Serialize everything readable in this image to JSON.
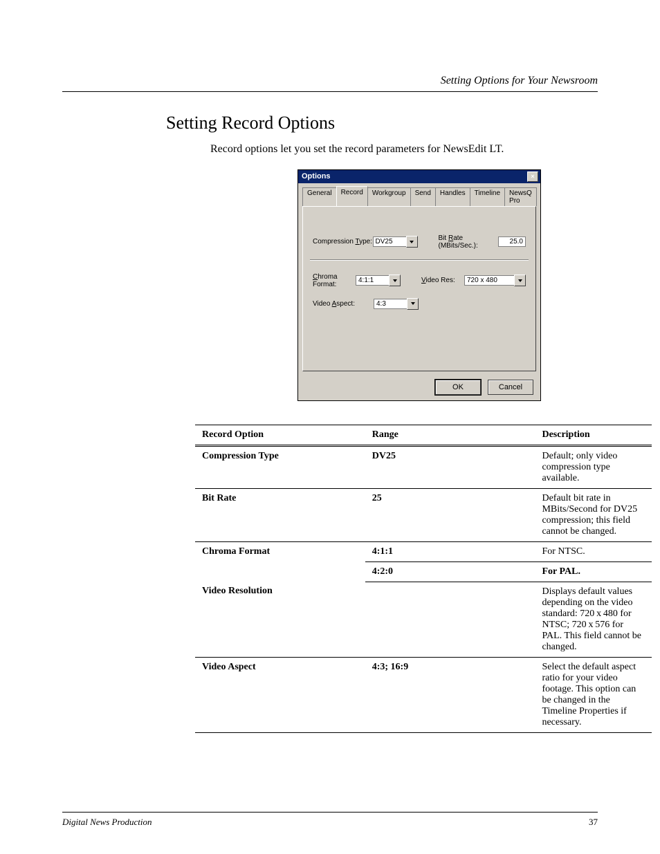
{
  "runningHead": "Setting Options for Your Newsroom",
  "section": {
    "title": "Setting Record Options",
    "para": "Record options let you set the record parameters for NewsEdit LT."
  },
  "dialog": {
    "title": "Options",
    "closeGlyph": "×",
    "tabs": [
      "General",
      "Record",
      "Workgroup",
      "Send",
      "Handles",
      "Timeline",
      "NewsQ Pro"
    ],
    "activeTabIndex": 1,
    "labels": {
      "compression": "Compression Type:",
      "bitrate": "Bit Rate (MBits/Sec.):",
      "chroma": "Chroma Format:",
      "videoRes": "Video Res:",
      "aspect": "Video Aspect:"
    },
    "values": {
      "compression": "DV25",
      "bitrate": "25.0",
      "chroma": "4:1:1",
      "videoRes": "720 x 480",
      "aspect": "4:3"
    },
    "buttons": {
      "ok": "OK",
      "cancel": "Cancel"
    }
  },
  "table": {
    "headers": [
      "Record Option",
      "Range",
      "Description"
    ],
    "rows": [
      {
        "opt": "Compression Type",
        "range": "DV25",
        "desc": "Default; only video compression type available."
      },
      {
        "opt": "Bit Rate",
        "range": "25",
        "desc": "Default bit rate in MBits/Second for DV25 compression; this field cannot be changed."
      },
      {
        "opt": "Chroma Format",
        "range": "4:1:1",
        "desc": "For NTSC.",
        "sub": true
      },
      {
        "opt": "",
        "range": "4:2:0",
        "desc": "For PAL."
      },
      {
        "opt": "Video Resolution",
        "range": "",
        "desc": "Displays default values depending on the video standard: 720 x 480 for NTSC; 720 x 576 for PAL. This field cannot be changed."
      },
      {
        "opt": "Video Aspect",
        "range": "4:3; 16:9",
        "desc": "Select the default aspect ratio for your video footage. This option can be changed in the Timeline Properties if necessary."
      }
    ]
  },
  "footer": {
    "manual": "Digital News Production",
    "page": "37"
  }
}
